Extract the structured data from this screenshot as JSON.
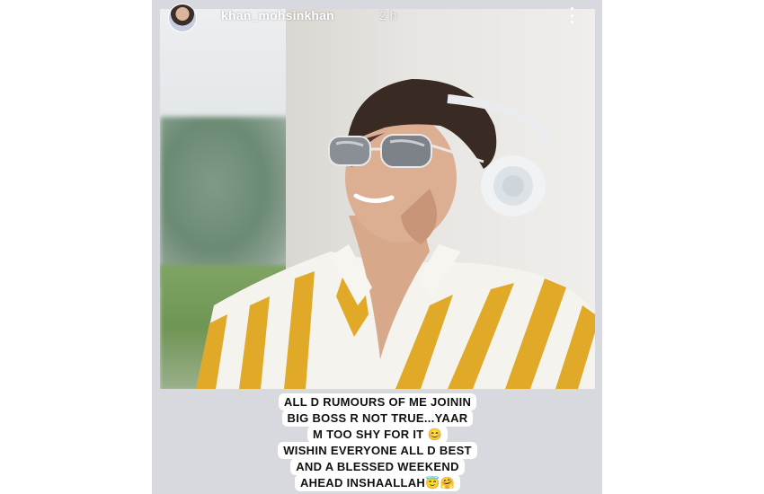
{
  "story": {
    "username": "khan_mohsinkhan",
    "time": "2 h",
    "caption_lines": [
      "ALL D RUMOURS OF ME JOININ",
      "BIG BOSS R NOT TRUE...YAAR",
      "M TOO SHY FOR IT 😊",
      "WISHIN EVERYONE ALL D BEST",
      "AND A BLESSED WEEKEND",
      "AHEAD INSHAALLAH😇🤗"
    ]
  },
  "colors": {
    "shirt_stripe": "#e0a928",
    "headphones": "#eef0f2",
    "background": "#d7d9de"
  },
  "icons": {
    "more": "more-vertical-icon"
  }
}
